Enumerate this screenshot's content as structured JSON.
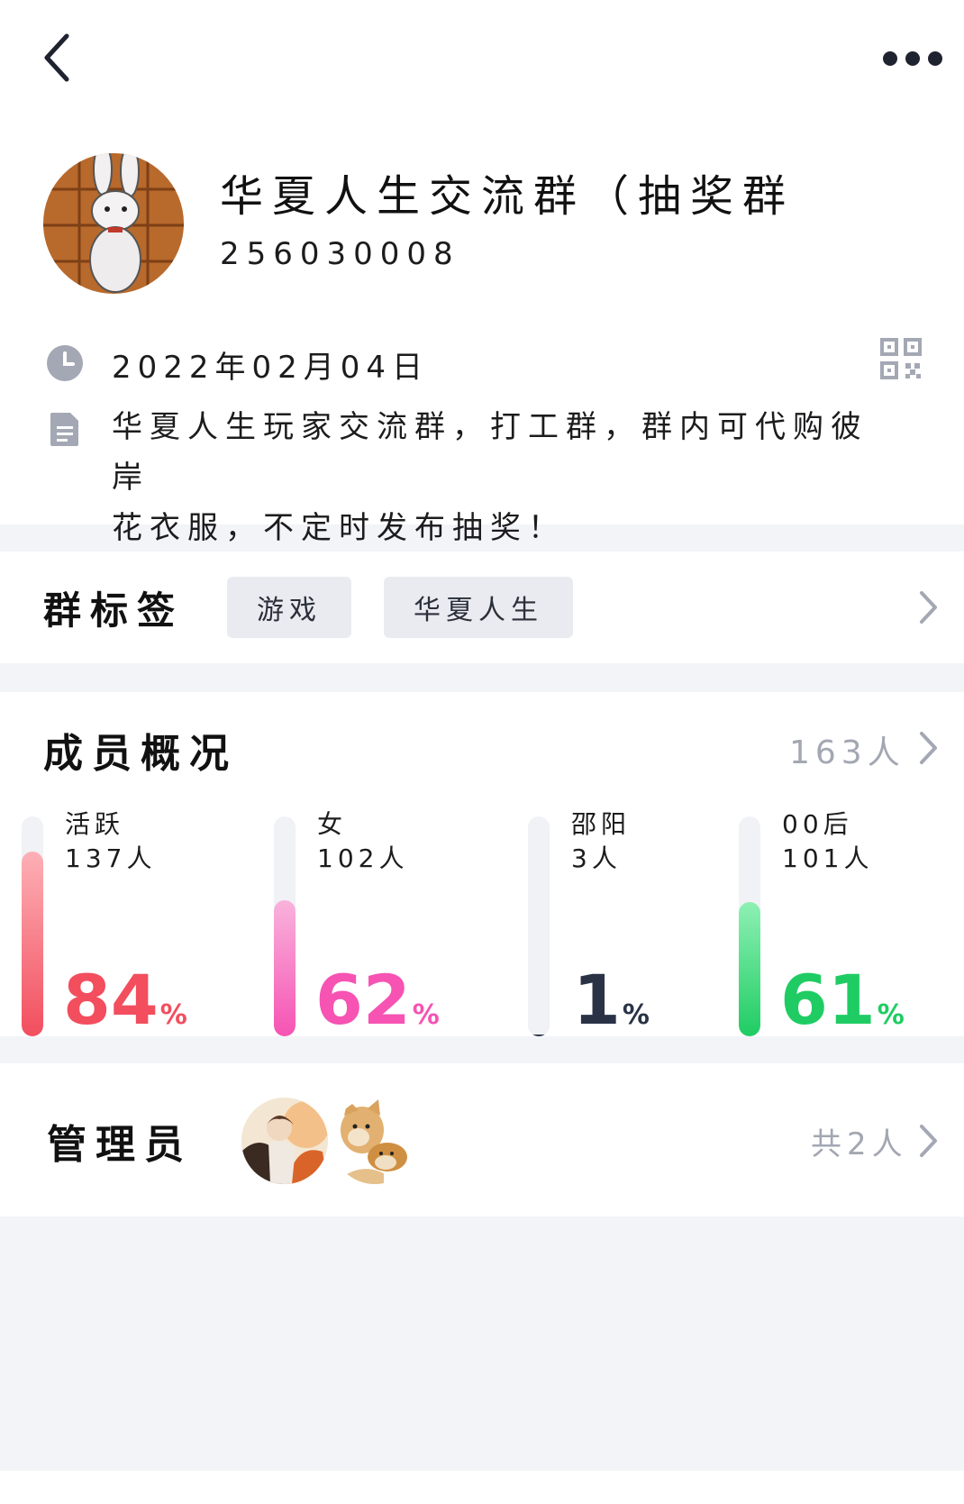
{
  "header": {
    "group_name": "华夏人生交流群（抽奖群",
    "group_id": "256030008",
    "created_date": "2022年02月04日",
    "description_line1": "华夏人生玩家交流群，打工群，群内可代购彼岸",
    "description_line2": "花衣服，不定时发布抽奖！"
  },
  "tags": {
    "title": "群标签",
    "items": [
      "游戏",
      "华夏人生"
    ]
  },
  "members": {
    "title": "成员概况",
    "count": "163人",
    "stats": [
      {
        "label": "活跃",
        "value": "137人",
        "percent": 84,
        "percent_text": "84",
        "unit": "%",
        "color": "#f24e5e"
      },
      {
        "label": "女",
        "value": "102人",
        "percent": 62,
        "percent_text": "62",
        "unit": "%",
        "color": "#f653b3"
      },
      {
        "label": "邵阳",
        "value": "3人",
        "percent": 1,
        "percent_text": "1",
        "unit": "%",
        "color": "#2a3346"
      },
      {
        "label": "00后",
        "value": "101人",
        "percent": 61,
        "percent_text": "61",
        "unit": "%",
        "color": "#1fcc63"
      }
    ]
  },
  "admins": {
    "title": "管理员",
    "count": "共2人"
  },
  "icons": {
    "back": "chevron-left-icon",
    "more": "more-dots-icon",
    "clock": "clock-icon",
    "qr": "qr-code-icon",
    "doc": "document-icon",
    "chevron": "chevron-right-icon"
  }
}
